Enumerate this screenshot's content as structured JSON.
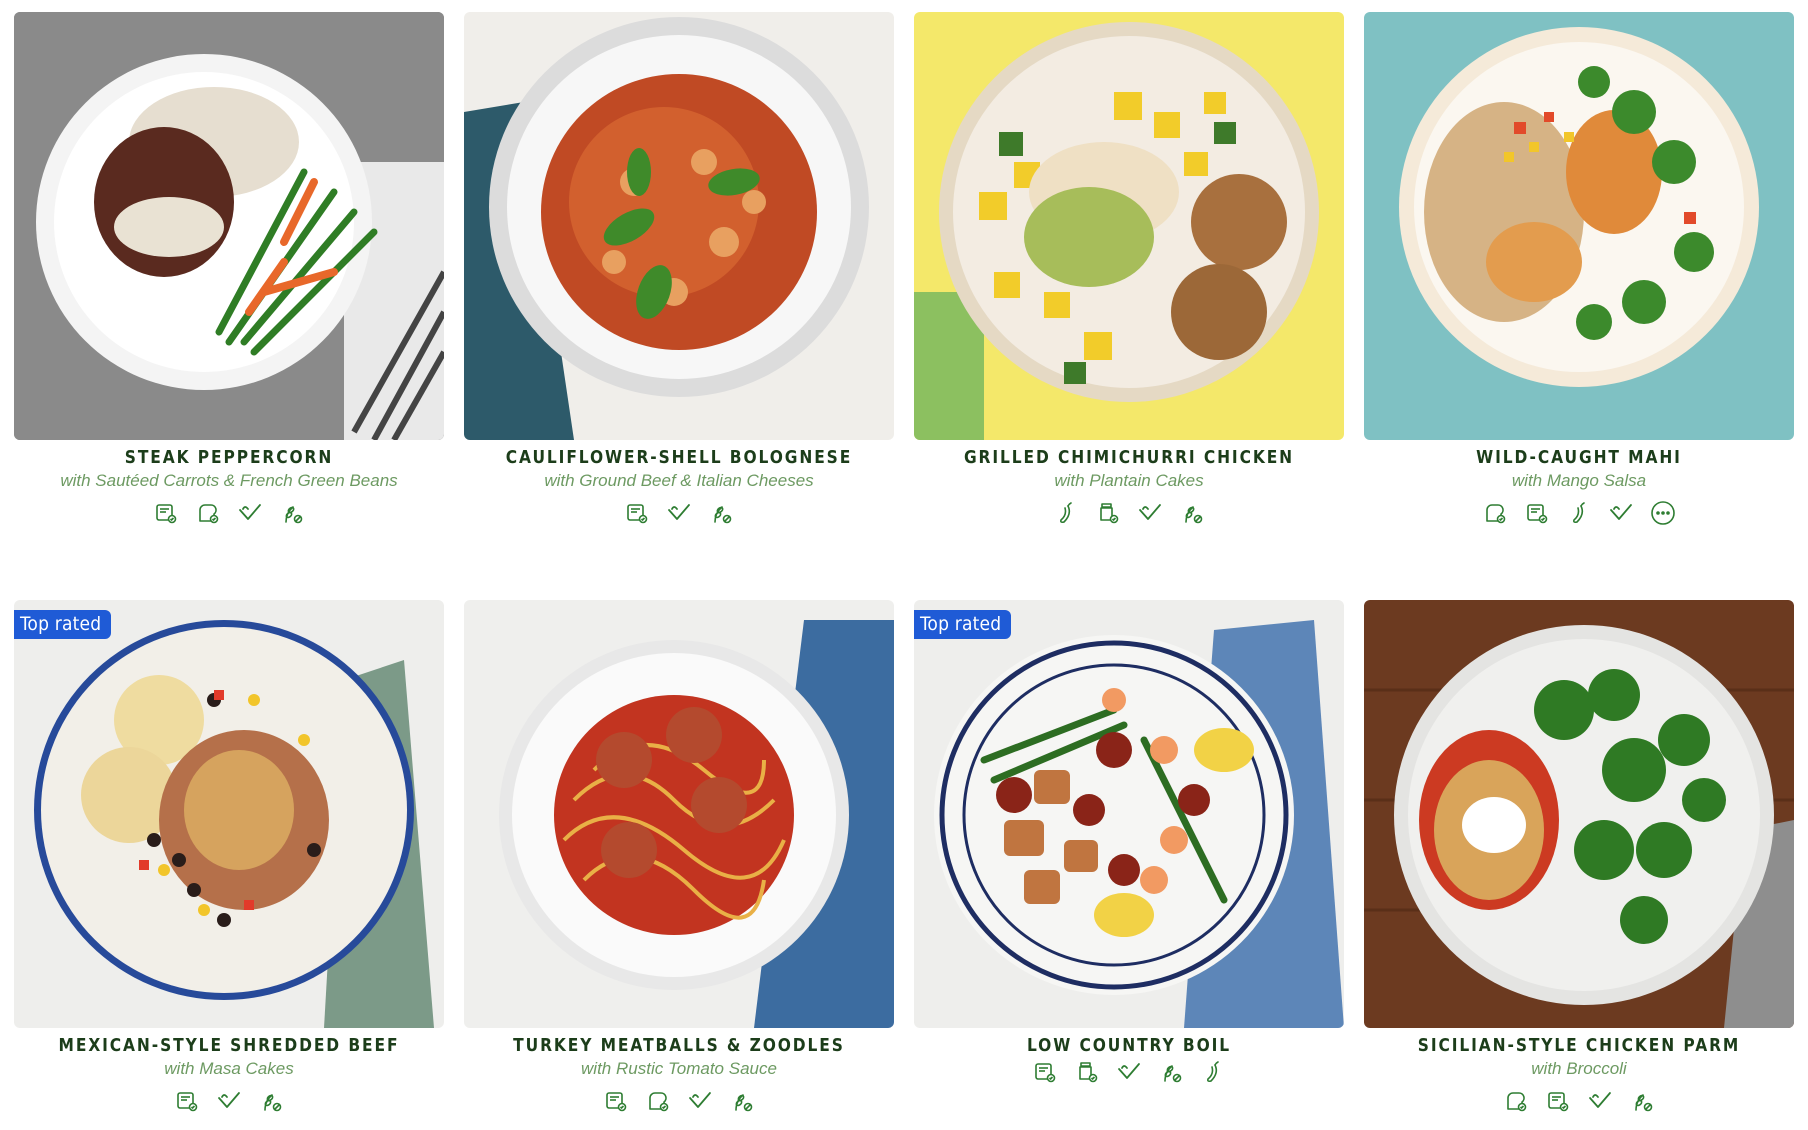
{
  "colors": {
    "title": "#1c3d1a",
    "subtitle": "#6d9a62",
    "icon": "#2e7d32",
    "badge": "#1f5bd6"
  },
  "meals": [
    {
      "title": "STEAK PEPPERCORN",
      "subtitle": "with Sautéed Carrots & French Green Beans",
      "badge": "",
      "icons": [
        "recipe-card-icon",
        "bread-icon",
        "heart-check-icon",
        "gluten-free-icon"
      ]
    },
    {
      "title": "CAULIFLOWER-SHELL BOLOGNESE",
      "subtitle": "with Ground Beef & Italian Cheeses",
      "badge": "",
      "icons": [
        "recipe-card-icon",
        "heart-check-icon",
        "gluten-free-icon"
      ]
    },
    {
      "title": "GRILLED CHIMICHURRI CHICKEN",
      "subtitle": "with Plantain Cakes",
      "badge": "",
      "icons": [
        "chili-icon",
        "jar-icon",
        "heart-check-icon",
        "gluten-free-icon"
      ]
    },
    {
      "title": "WILD-CAUGHT MAHI",
      "subtitle": "with Mango Salsa",
      "badge": "",
      "icons": [
        "bread-icon",
        "recipe-card-icon",
        "chili-icon",
        "heart-check-icon",
        "more-icon"
      ]
    },
    {
      "title": "MEXICAN-STYLE SHREDDED BEEF",
      "subtitle": "with Masa Cakes",
      "badge": "Top rated",
      "icons": [
        "recipe-card-icon",
        "heart-check-icon",
        "gluten-free-icon"
      ]
    },
    {
      "title": "TURKEY MEATBALLS & ZOODLES",
      "subtitle": "with Rustic Tomato Sauce",
      "badge": "",
      "icons": [
        "recipe-card-icon",
        "bread-icon",
        "heart-check-icon",
        "gluten-free-icon"
      ]
    },
    {
      "title": "LOW COUNTRY BOIL",
      "subtitle": "",
      "badge": "Top rated",
      "icons": [
        "recipe-card-icon",
        "jar-icon",
        "heart-check-icon",
        "gluten-free-icon",
        "chili-icon"
      ]
    },
    {
      "title": "SICILIAN-STYLE CHICKEN PARM",
      "subtitle": "with Broccoli",
      "badge": "",
      "icons": [
        "bread-icon",
        "recipe-card-icon",
        "heart-check-icon",
        "gluten-free-icon"
      ]
    }
  ]
}
